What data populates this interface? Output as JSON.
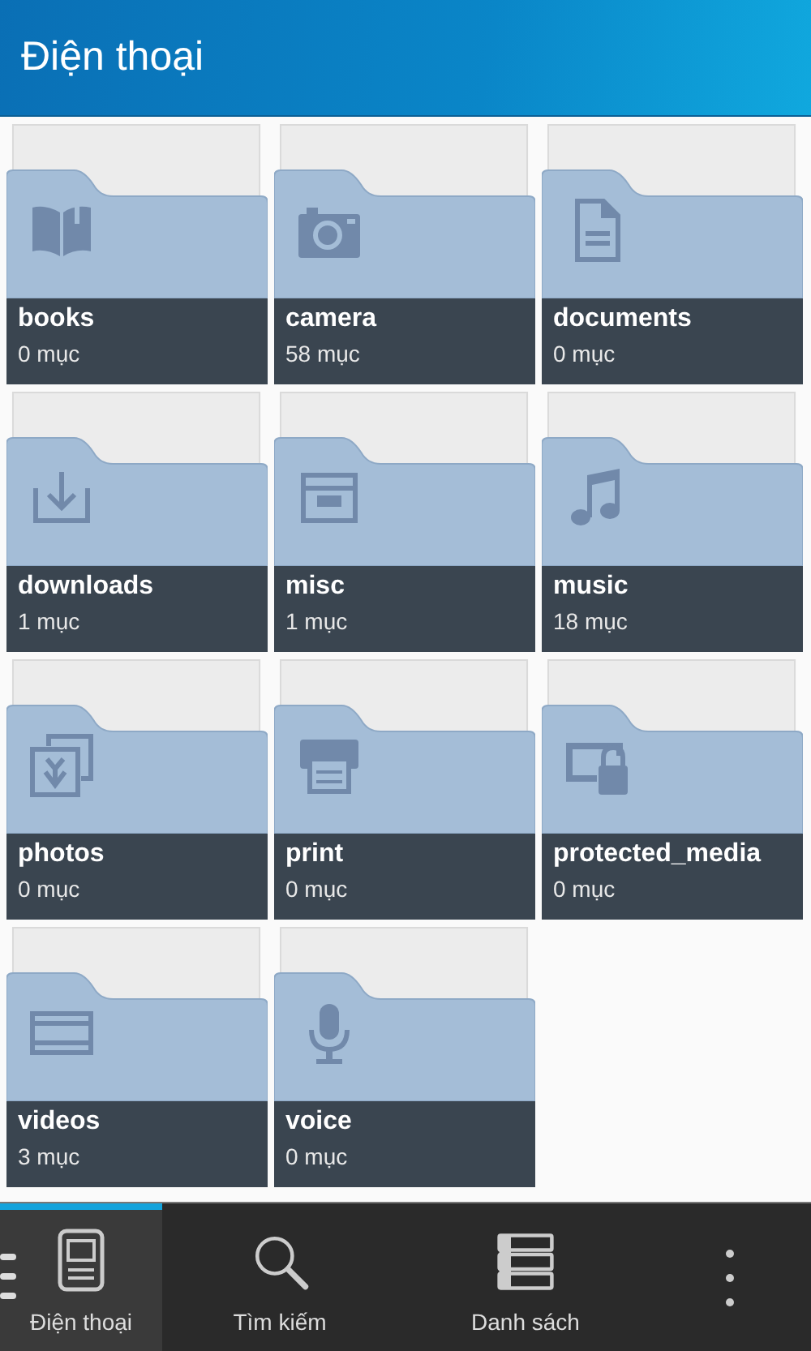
{
  "header": {
    "title": "Điện thoại"
  },
  "folders": [
    {
      "name": "books",
      "count": "0 mục"
    },
    {
      "name": "camera",
      "count": "58 mục"
    },
    {
      "name": "documents",
      "count": "0 mục"
    },
    {
      "name": "downloads",
      "count": "1 mục"
    },
    {
      "name": "misc",
      "count": "1 mục"
    },
    {
      "name": "music",
      "count": "18 mục"
    },
    {
      "name": "photos",
      "count": "0 mục"
    },
    {
      "name": "print",
      "count": "0 mục"
    },
    {
      "name": "protected_media",
      "count": "0 mục"
    },
    {
      "name": "videos",
      "count": "3 mục"
    },
    {
      "name": "voice",
      "count": "0 mục"
    }
  ],
  "action_bar": {
    "tabs": [
      {
        "label": "Điện thoại",
        "selected": true
      },
      {
        "label": "Tìm kiếm",
        "selected": false
      },
      {
        "label": "Danh sách",
        "selected": false
      }
    ]
  }
}
